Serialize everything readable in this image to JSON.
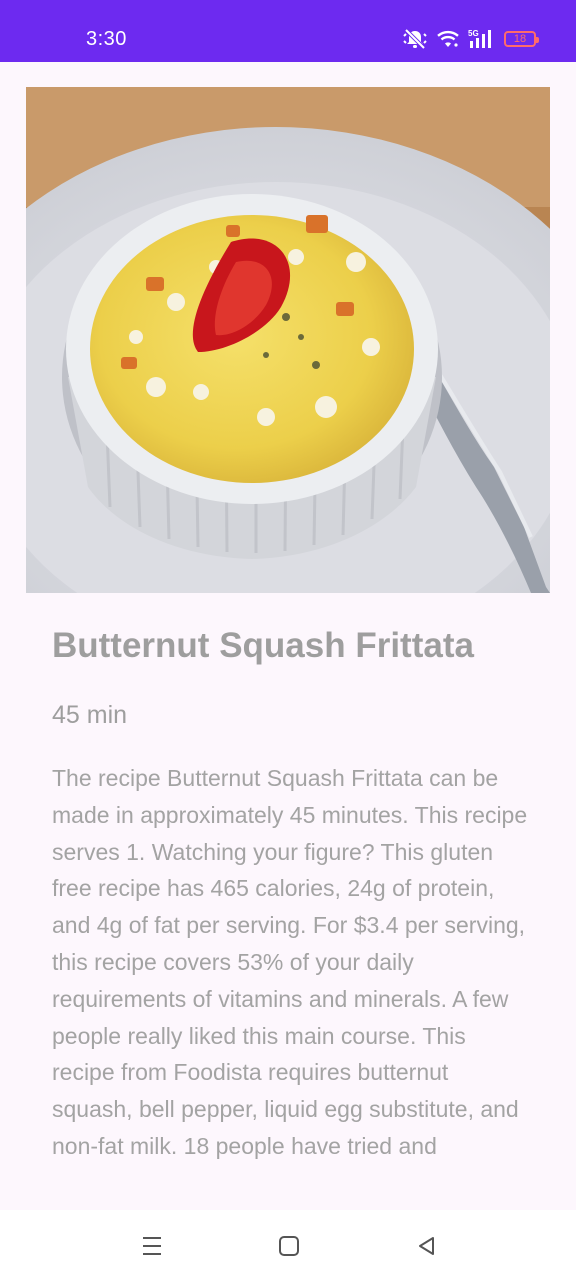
{
  "status_bar": {
    "time": "3:30",
    "battery_level": "18",
    "icons": [
      "mute-vibrate-icon",
      "wifi-icon",
      "cellular-5g-icon",
      "battery-icon"
    ],
    "colors": {
      "background": "#6d2af0",
      "battery": "#ff6b6b"
    }
  },
  "recipe": {
    "image_alt": "Butternut Squash Frittata",
    "title": "Butternut Squash Frittata",
    "ready_time": "45 min",
    "summary": "The recipe Butternut Squash Frittata can be made in approximately 45 minutes. This recipe serves 1. Watching your figure? This gluten free recipe has 465 calories, 24g of protein, and 4g of fat per serving. For $3.4 per serving, this recipe covers 53% of your daily requirements of vitamins and minerals. A few people really liked this main course. This recipe from Foodista requires butternut squash, bell pepper, liquid egg substitute, and non-fat milk. 18 people have tried and"
  },
  "nav_bar": {
    "buttons": [
      "menu-icon",
      "home-icon",
      "back-icon"
    ]
  },
  "colors": {
    "page_background": "#fdf7fd",
    "text": "#9e9e9e"
  }
}
